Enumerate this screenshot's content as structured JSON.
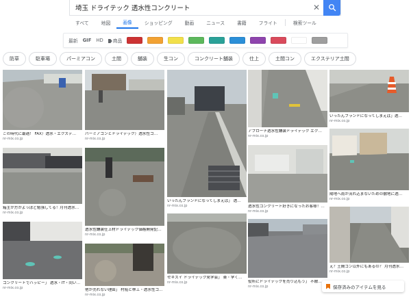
{
  "search": {
    "query": "埼玉 ドライテック 透水性コンクリート",
    "clear_icon": "close-icon",
    "search_icon": "search-icon"
  },
  "tabs": [
    {
      "label": "すべて",
      "active": false
    },
    {
      "label": "地図",
      "active": false
    },
    {
      "label": "画像",
      "active": true
    },
    {
      "label": "ショッピング",
      "active": false
    },
    {
      "label": "動画",
      "active": false
    },
    {
      "label": "ニュース",
      "active": false
    },
    {
      "label": "書籍",
      "active": false
    },
    {
      "label": "フライト",
      "active": false
    },
    {
      "label": "検索ツール",
      "active": false
    }
  ],
  "filters": {
    "recent": "最新",
    "gif": "GIF",
    "hd": "HD",
    "product": "商品",
    "colors": [
      "#cc3333",
      "#f2a233",
      "#f2e04a",
      "#5cb85c",
      "#2aa198",
      "#2b8fd8",
      "#8e44ad",
      "#d94a5c",
      "#ffffff",
      "#9e9e9e"
    ]
  },
  "chips": [
    "防草",
    "駐車場",
    "パーミアコン",
    "土間",
    "舗装",
    "生コン",
    "コンクリート舗装",
    "仕上",
    "土間コン",
    "エクステリア土間"
  ],
  "results": {
    "col1": [
      {
        "caption": "この時代に最適！ FAX）透水・エクステ…",
        "source": "nr-mix.co.jp"
      },
      {
        "caption": "箱主が方がよっぽど勉強してる！月刊透水…",
        "source": "nr-mix.co.jp"
      },
      {
        "caption": "コンクリートでハッピー」 透水・IT・同い…",
        "source": "nr-mix.co.jp"
      }
    ],
    "col2": [
      {
        "caption": "パーミアコンとドライテック）透水性コ…",
        "source": "nr-mix.co.jp"
      },
      {
        "caption": "透水性舗装仕上材ドライテック価格開発記…",
        "source": "nr-mix.co.jp"
      },
      {
        "caption": "他が売れない理由」 村船と林工・透水性コ…",
        "source": "nr-mix.co.jp"
      }
    ],
    "col3": [
      {
        "caption": "いったんブランドになってしまえば」 透…",
        "source": "nr-mix.co.jp"
      },
      {
        "caption": "セキスイ ドライテック見学会」 楽・学く…",
        "source": "nr-mix.co.jp"
      }
    ],
    "col4": [
      {
        "caption": "アプローチ透水性舗装ドライテック エク…",
        "source": "nr-mix.co.jp"
      },
      {
        "caption": "透水性コンクリート好きになったお客様！…",
        "source": "nr-mix.co.jp"
      },
      {
        "caption": "役所にドライテックを売り込もう」 不敵…",
        "source": "nr-mix.co.jp"
      }
    ],
    "col5": [
      {
        "caption": "いったんブランドになってしまえば」透…",
        "source": "nr-mix.co.jp"
      },
      {
        "caption": "陽地へ雨が流れ込まないための敷地に透…",
        "source": "nr-mix.co.jp"
      },
      {
        "caption": "え？土間コン以外にもあるの？ 月刊透水…",
        "source": "nr-mix.co.jp"
      }
    ]
  },
  "saved_items": {
    "label": "保存済みのアイテムを見る",
    "icon": "bookmark-icon"
  }
}
